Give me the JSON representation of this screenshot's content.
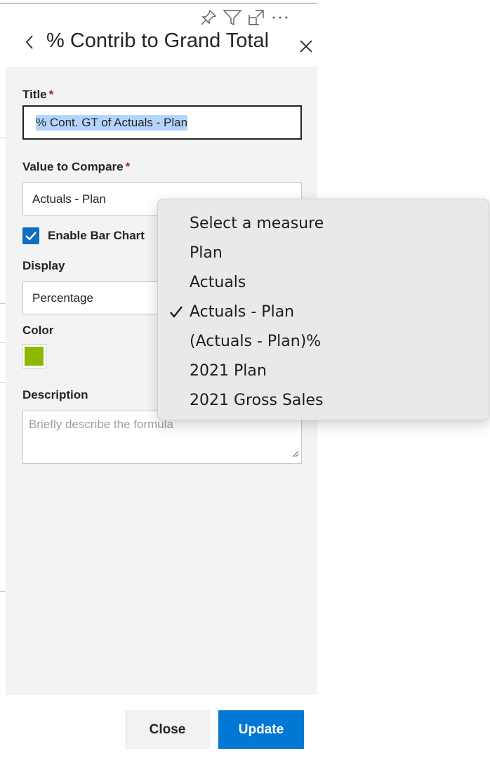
{
  "header": {
    "title": "% Contrib to Grand Total",
    "toolbar_icons": [
      "pin-icon",
      "filter-icon",
      "focus-mode-icon",
      "more-options-icon"
    ]
  },
  "form": {
    "title_label": "Title",
    "title_value": "% Cont. GT of Actuals - Plan",
    "compare_label": "Value to Compare",
    "compare_value": "Actuals - Plan",
    "enable_bar_chart_label": "Enable Bar Chart",
    "enable_bar_chart_checked": true,
    "display_label": "Display",
    "display_value": "Percentage",
    "color_label": "Color",
    "color_value": "#8cb800",
    "description_label": "Description",
    "description_placeholder": "Briefly describe the formula",
    "required_marker": "*"
  },
  "footer": {
    "close_label": "Close",
    "update_label": "Update"
  },
  "measure_menu": {
    "items": [
      {
        "label": "Select a measure",
        "selected": false
      },
      {
        "label": "Plan",
        "selected": false
      },
      {
        "label": "Actuals",
        "selected": false
      },
      {
        "label": "Actuals - Plan",
        "selected": true
      },
      {
        "label": "(Actuals - Plan)%",
        "selected": false
      },
      {
        "label": "2021 Plan",
        "selected": false
      },
      {
        "label": "2021 Gross Sales",
        "selected": false
      }
    ]
  },
  "colors": {
    "accent": "#0078d4",
    "checkbox": "#106ebe",
    "required": "#a4262c",
    "panel_body": "#f3f3f3"
  }
}
